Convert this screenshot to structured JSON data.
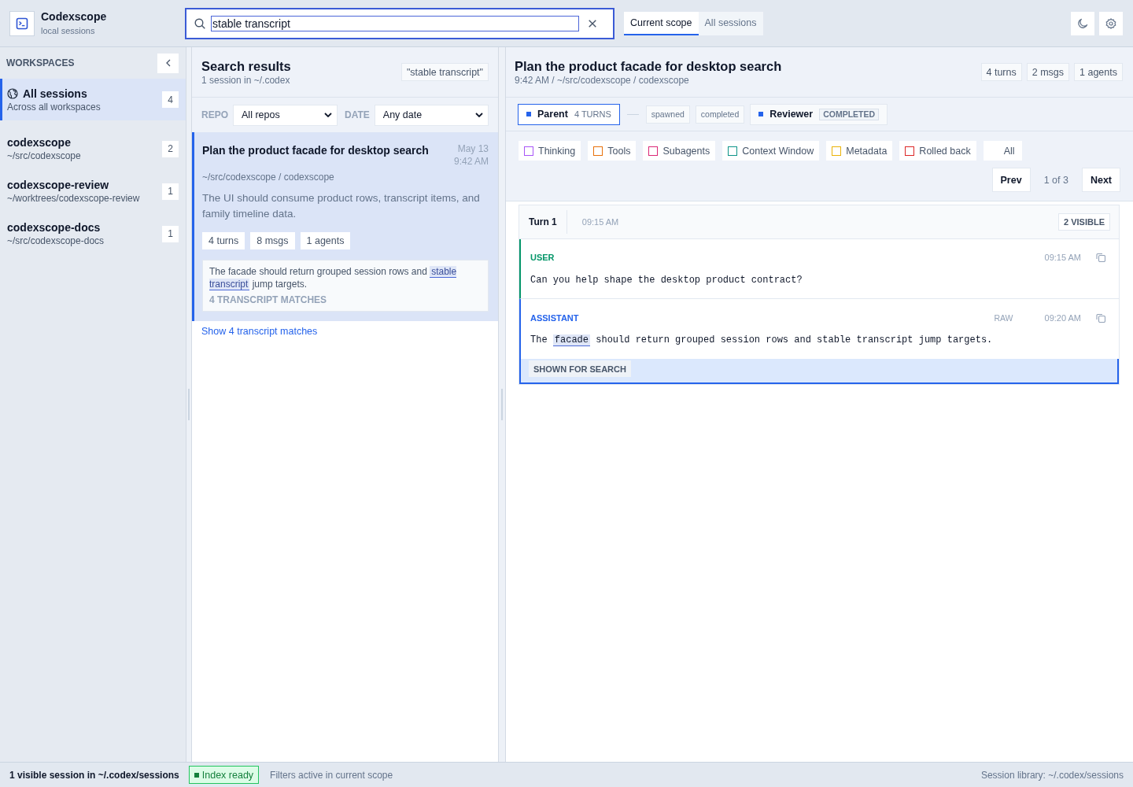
{
  "app": {
    "title": "Codexscope",
    "subtitle": "local sessions"
  },
  "search": {
    "value": "stable transcript"
  },
  "scope_tabs": [
    {
      "label": "Current scope",
      "selected": true
    },
    {
      "label": "All sessions",
      "selected": false
    }
  ],
  "sidebar": {
    "heading": "WORKSPACES",
    "items": [
      {
        "kind": "all",
        "name": "All sessions",
        "path": "Across all workspaces",
        "count": "4",
        "selected": true
      },
      {
        "kind": "workspace",
        "name": "codexscope",
        "path": "~/src/codexscope",
        "count": "2",
        "selected": false
      },
      {
        "kind": "workspace",
        "name": "codexscope-review",
        "path": "~/worktrees/codexscope-review",
        "count": "1",
        "selected": false
      },
      {
        "kind": "workspace",
        "name": "codexscope-docs",
        "path": "~/src/codexscope-docs",
        "count": "1",
        "selected": false
      }
    ]
  },
  "results": {
    "title": "Search results",
    "subtitle": "1 session in ~/.codex",
    "query": "\"stable transcript\"",
    "filters": [
      {
        "label": "REPO",
        "value": "All repos"
      },
      {
        "label": "DATE",
        "value": "Any date"
      }
    ],
    "items": [
      {
        "title": "Plan the product facade for desktop search",
        "date": "May 13",
        "time": "9:42 AM",
        "path": "~/src/codexscope / codexscope",
        "summary": "The UI should consume product rows, transcript items, and family timeline data.",
        "chips": [
          "4 turns",
          "8 msgs",
          "1 agents"
        ],
        "snippet": [
          {
            "text": "The facade should return grouped session rows and ",
            "match": false
          },
          {
            "text": "stable transcript",
            "match": true
          },
          {
            "text": " jump targets.",
            "match": false
          }
        ],
        "match_count": "4 TRANSCRIPT MATCHES",
        "selected": true
      }
    ],
    "show_more": "Show 4 transcript matches"
  },
  "detail": {
    "title": "Plan the product facade for desktop search",
    "subtitle": "9:42 AM / ~/src/codexscope / codexscope",
    "chips": [
      "4 turns",
      "2 msgs",
      "1 agents"
    ],
    "timeline": [
      {
        "kind": "node",
        "label": "Parent",
        "meta": "4 TURNS",
        "selected": true
      },
      {
        "kind": "connector"
      },
      {
        "kind": "event",
        "label": "spawned"
      },
      {
        "kind": "event",
        "label": "completed"
      },
      {
        "kind": "node",
        "label": "Reviewer",
        "status": "COMPLETED",
        "selected": false
      }
    ],
    "filters": [
      {
        "label": "Thinking",
        "checked": false,
        "color": "#a855f7"
      },
      {
        "label": "Tools",
        "checked": false,
        "color": "#e8710a"
      },
      {
        "label": "Subagents",
        "checked": false,
        "color": "#db2777"
      },
      {
        "label": "Context Window",
        "checked": false,
        "color": "#0d9488"
      },
      {
        "label": "Metadata",
        "checked": false,
        "color": "#eab308"
      },
      {
        "label": "Rolled back",
        "checked": false,
        "color": "#dc2626"
      }
    ],
    "all_filter": "All",
    "pager": {
      "prev": "Prev",
      "position": "1 of 3",
      "next": "Next"
    },
    "turns": [
      {
        "title": "Turn 1",
        "time": "09:15 AM",
        "visible": "2 VISIBLE",
        "messages": [
          {
            "kind": "user",
            "role": "USER",
            "time": "09:15 AM",
            "text": [
              {
                "text": "Can you help shape the desktop product contract?",
                "match": false
              }
            ],
            "highlighted": false
          },
          {
            "kind": "assistant",
            "role": "ASSISTANT",
            "tag": "RAW",
            "time": "09:20 AM",
            "text": [
              {
                "text": "The ",
                "match": false
              },
              {
                "text": "facade",
                "match": true
              },
              {
                "text": " should return grouped session rows and stable transcript jump targets.",
                "match": false
              }
            ],
            "highlighted": true,
            "match_label": "SHOWN FOR SEARCH"
          }
        ]
      }
    ]
  },
  "status_bar": {
    "sessions": "1 visible session in ~/.codex/sessions",
    "index": "Index ready",
    "filters": "Filters active in current scope",
    "library": "Session library: ~/.codex/sessions"
  }
}
